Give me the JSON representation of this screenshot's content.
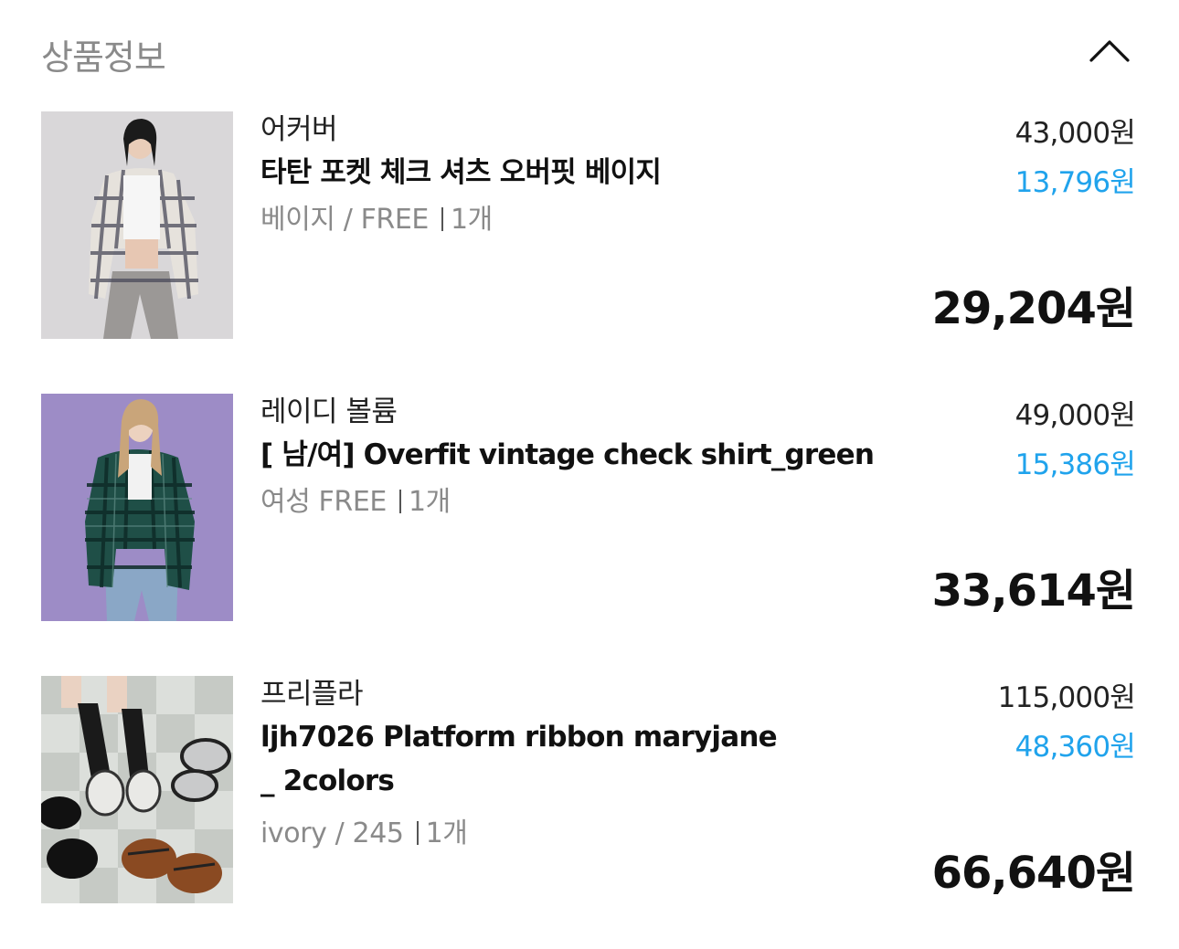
{
  "section": {
    "title": "상품정보",
    "toggle_icon": "chevron-up-icon"
  },
  "items": [
    {
      "brand": "어커버",
      "name": "타탄 포켓 체크 셔츠 오버핏 베이지",
      "option": "베이지 / FREE",
      "quantity": "1개",
      "original_price": "43,000원",
      "discount": "13,796원",
      "final_price": "29,204원"
    },
    {
      "brand": "레이디 볼륨",
      "name": "[ 남/여] Overfit vintage check shirt_green",
      "option": "여성 FREE",
      "quantity": "1개",
      "original_price": "49,000원",
      "discount": "15,386원",
      "final_price": "33,614원"
    },
    {
      "brand": "프리플라",
      "name": "ljh7026 Platform ribbon maryjane _ 2colors",
      "option": "ivory / 245",
      "quantity": "1개",
      "original_price": "115,000원",
      "discount": "48,360원",
      "final_price": "66,640원"
    }
  ],
  "colors": {
    "discount": "#20a3ec",
    "muted": "#8a8a8a"
  }
}
